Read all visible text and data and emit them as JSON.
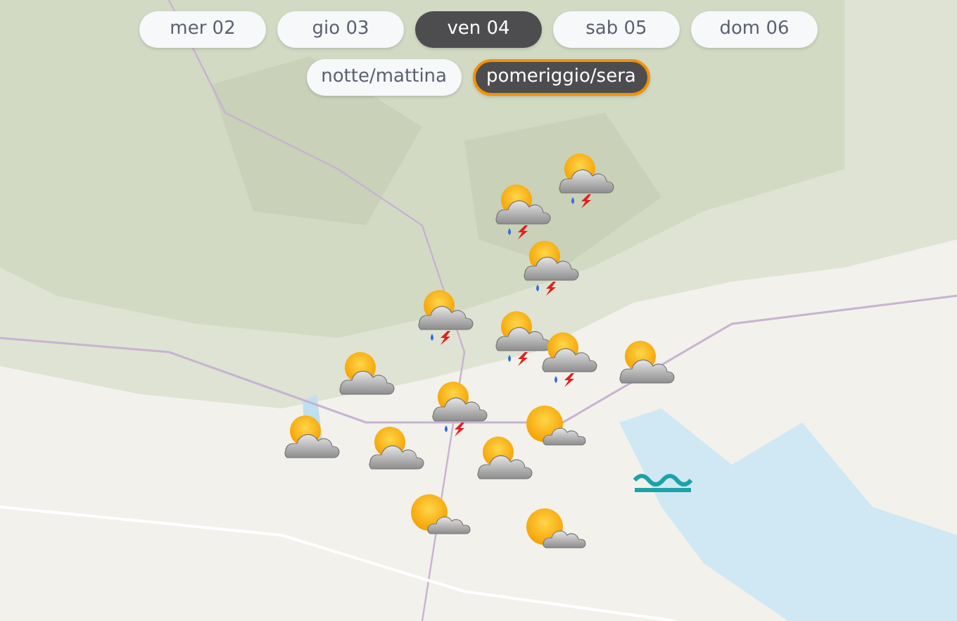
{
  "days": [
    {
      "label": "mer 02",
      "selected": false
    },
    {
      "label": "gio 03",
      "selected": false
    },
    {
      "label": "ven 04",
      "selected": true
    },
    {
      "label": "sab 05",
      "selected": false
    },
    {
      "label": "dom 06",
      "selected": false
    }
  ],
  "periods": [
    {
      "label": "notte/mattina",
      "selected": false
    },
    {
      "label": "pomeriggio/sera",
      "selected": true
    }
  ],
  "markers": [
    {
      "kind": "storm"
    },
    {
      "kind": "storm"
    },
    {
      "kind": "storm"
    },
    {
      "kind": "storm"
    },
    {
      "kind": "storm"
    },
    {
      "kind": "storm"
    },
    {
      "kind": "cloudy"
    },
    {
      "kind": "cloudy"
    },
    {
      "kind": "storm"
    },
    {
      "kind": "cloudy"
    },
    {
      "kind": "cloudy"
    },
    {
      "kind": "partly"
    },
    {
      "kind": "cloudy"
    },
    {
      "kind": "sea"
    },
    {
      "kind": "partly"
    },
    {
      "kind": "partly"
    }
  ]
}
